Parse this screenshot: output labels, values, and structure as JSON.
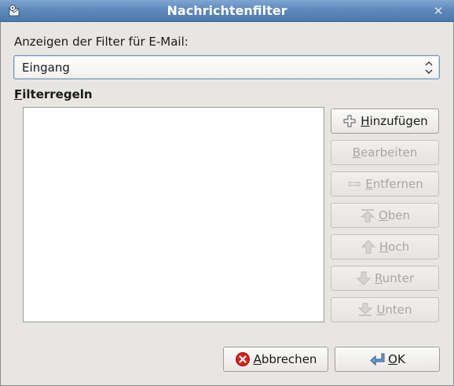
{
  "window": {
    "title": "Nachrichtenfilter",
    "close_glyph": "✕"
  },
  "filter_for": {
    "label": "Anzeigen der Filter für E-Mail:",
    "selected": "Eingang"
  },
  "rules": {
    "label_first": "F",
    "label_rest": "ilterregeln",
    "items": []
  },
  "buttons": {
    "add": {
      "mnemonic": "H",
      "rest": "inzufügen",
      "icon": "plus-icon",
      "enabled": true
    },
    "edit": {
      "mnemonic": "B",
      "rest": "earbeiten",
      "icon": "",
      "enabled": false
    },
    "remove": {
      "mnemonic": "E",
      "rest": "ntfernen",
      "icon": "minus-icon",
      "enabled": false
    },
    "top": {
      "mnemonic": "O",
      "rest": "ben",
      "icon": "arrow-top-icon",
      "enabled": false
    },
    "up": {
      "mnemonic": "H",
      "rest": "och",
      "icon": "arrow-up-icon",
      "enabled": false
    },
    "down": {
      "mnemonic": "R",
      "rest": "unter",
      "icon": "arrow-down-icon",
      "enabled": false
    },
    "bottom": {
      "mnemonic": "U",
      "rest": "nten",
      "icon": "arrow-bottom-icon",
      "enabled": false
    },
    "cancel": {
      "mnemonic": "A",
      "rest": "bbrechen",
      "icon": "cancel-icon",
      "enabled": true
    },
    "ok": {
      "mnemonic": "O",
      "rest": "K",
      "icon": "enter-arrow-icon",
      "enabled": true
    }
  },
  "colors": {
    "titlebar": "#5f8abb",
    "background": "#e8e6e2",
    "disabled_text": "#a9a7a3",
    "cancel_red": "#d8201c"
  }
}
